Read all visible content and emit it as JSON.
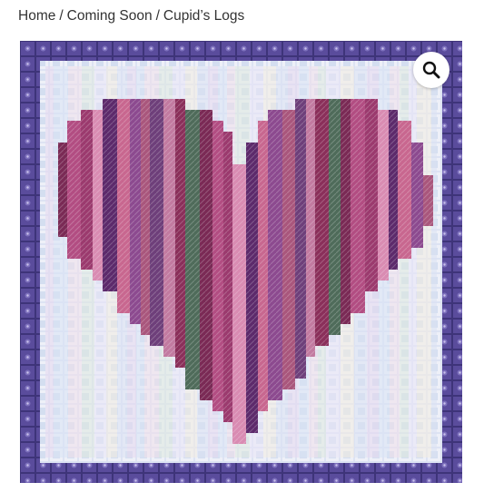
{
  "breadcrumb": {
    "items": [
      {
        "label": "Home"
      },
      {
        "label": "Coming Soon"
      },
      {
        "label": "Cupid’s Logs"
      }
    ],
    "separator": "/"
  },
  "gallery": {
    "zoom_icon": "magnifier-icon",
    "image_subject": "needlepoint heart in log-cabin strips",
    "colors": {
      "border_dark": "#3e3479",
      "border_mid": "#6a5aa8",
      "background_light": "#dfe4f2",
      "heart_dark": "#7a2a55",
      "heart_mid": "#b24d82",
      "heart_light": "#d98bb2"
    }
  }
}
